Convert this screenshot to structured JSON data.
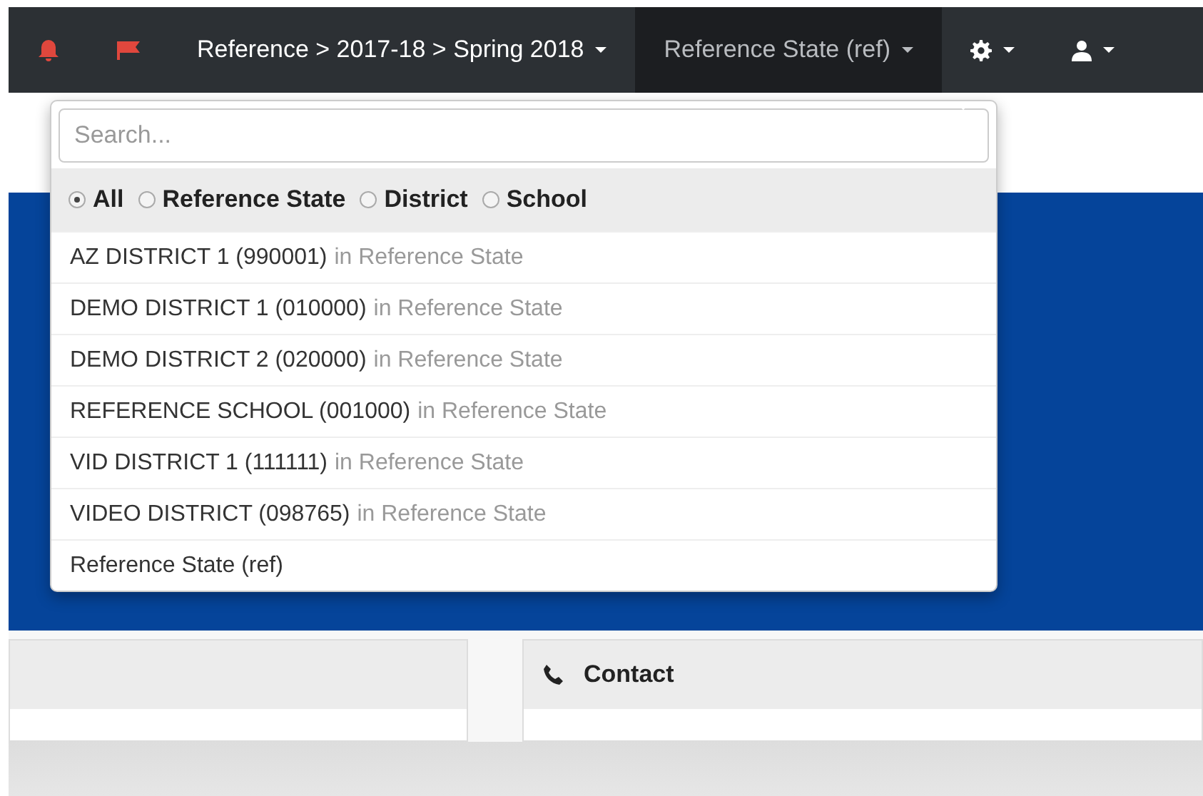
{
  "navbar": {
    "breadcrumb": "Reference > 2017-18 > Spring 2018",
    "organization": {
      "label": "Reference State (ref)",
      "expanded": true
    }
  },
  "org_dropdown": {
    "search": {
      "placeholder": "Search..."
    },
    "filters": [
      {
        "label": "All",
        "selected": true
      },
      {
        "label": "Reference State",
        "selected": false
      },
      {
        "label": "District",
        "selected": false
      },
      {
        "label": "School",
        "selected": false
      }
    ],
    "results": [
      {
        "name": "AZ DISTRICT 1 (990001)",
        "context": "in Reference State"
      },
      {
        "name": "DEMO DISTRICT 1 (010000)",
        "context": "in Reference State"
      },
      {
        "name": "DEMO DISTRICT 2 (020000)",
        "context": "in Reference State"
      },
      {
        "name": "REFERENCE SCHOOL (001000)",
        "context": "in Reference State"
      },
      {
        "name": "VID DISTRICT 1 (111111)",
        "context": "in Reference State"
      },
      {
        "name": "VIDEO DISTRICT (098765)",
        "context": "in Reference State"
      },
      {
        "name": "Reference State (ref)"
      }
    ]
  },
  "contact_panel": {
    "title": "Contact"
  }
}
